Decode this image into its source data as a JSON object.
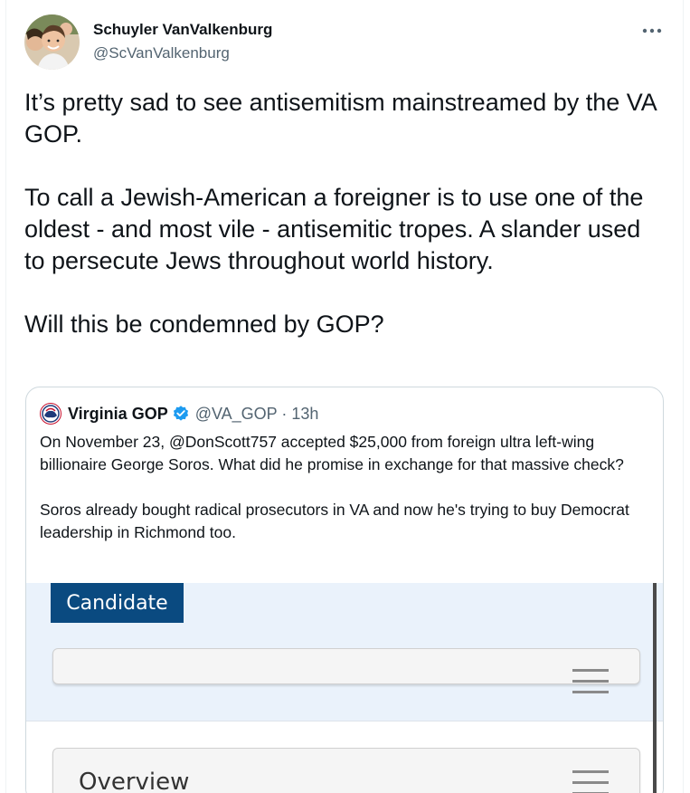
{
  "tweet": {
    "author_name": "Schuyler VanValkenburg",
    "author_handle": "@ScVanValkenburg",
    "paragraphs": [
      "It’s pretty sad to see antisemitism mainstreamed by the VA GOP.",
      "To call a Jewish-American a foreigner is to use one of the oldest - and most vile - antisemitic tropes. A slander used to persecute Jews throughout world history.",
      "Will this be condemned by GOP?"
    ]
  },
  "quoted": {
    "name": "Virginia GOP",
    "handle_time": "@VA_GOP · 13h",
    "paragraphs": [
      "On November 23, @DonScott757 accepted $25,000 from foreign ultra left-wing billionaire George Soros. What did he promise in exchange for that massive check?",
      "Soros already bought radical prosecutors in VA and now he's trying to buy Democrat leadership in Richmond too."
    ],
    "media": {
      "candidate_label": "Candidate",
      "overview_label": "Overview"
    }
  },
  "colors": {
    "verified_blue": "#1d9bf0",
    "candidate_bg": "#0a4a80",
    "media_top_bg": "#eaf2fb"
  },
  "icons": [
    "more-icon",
    "verified-badge-icon",
    "menu-icon"
  ]
}
